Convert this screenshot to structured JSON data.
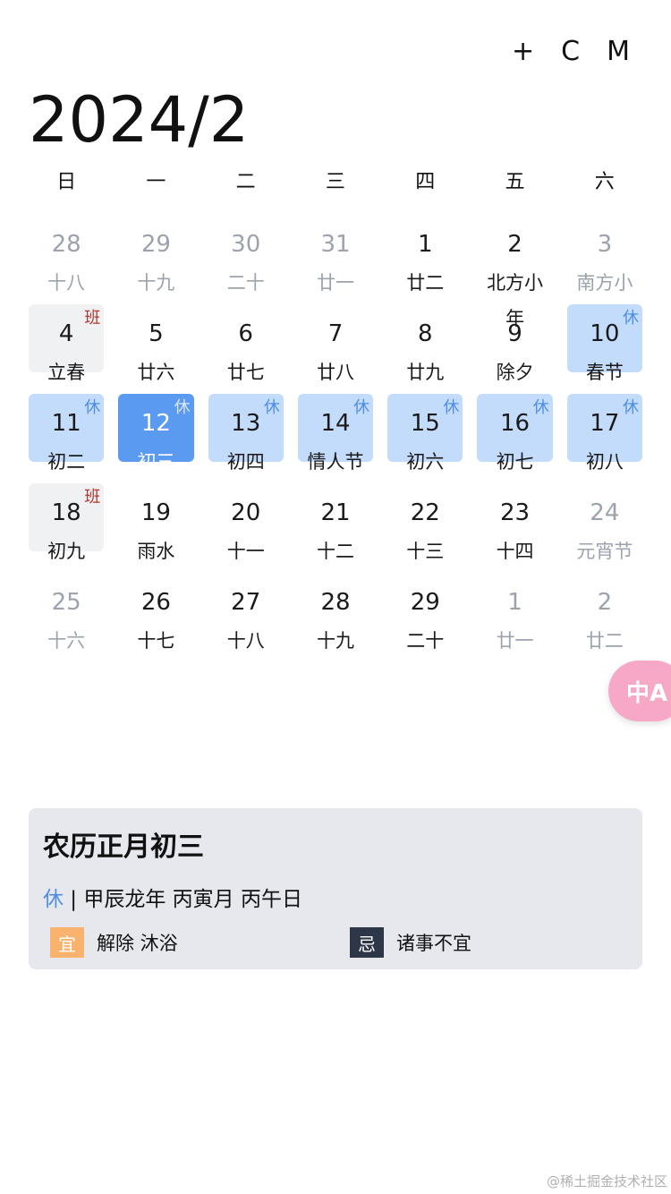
{
  "toolbar": {
    "add_label": "+",
    "c_label": "C",
    "m_label": "M"
  },
  "title": "2024/2",
  "weekdays": [
    "日",
    "一",
    "二",
    "三",
    "四",
    "五",
    "六"
  ],
  "days": [
    {
      "day": "28",
      "lunar": "十八",
      "other": true
    },
    {
      "day": "29",
      "lunar": "十九",
      "other": true
    },
    {
      "day": "30",
      "lunar": "二十",
      "other": true
    },
    {
      "day": "31",
      "lunar": "廿一",
      "other": true
    },
    {
      "day": "1",
      "lunar": "廿二"
    },
    {
      "day": "2",
      "lunar": "北方小年"
    },
    {
      "day": "3",
      "lunar": "南方小年",
      "other": true
    },
    {
      "day": "4",
      "lunar": "立春",
      "status": "work",
      "tag": "班"
    },
    {
      "day": "5",
      "lunar": "廿六"
    },
    {
      "day": "6",
      "lunar": "廿七"
    },
    {
      "day": "7",
      "lunar": "廿八"
    },
    {
      "day": "8",
      "lunar": "廿九"
    },
    {
      "day": "9",
      "lunar": "除夕"
    },
    {
      "day": "10",
      "lunar": "春节",
      "status": "rest",
      "tag": "休"
    },
    {
      "day": "11",
      "lunar": "初二",
      "status": "rest",
      "tag": "休"
    },
    {
      "day": "12",
      "lunar": "初三",
      "status": "rest",
      "tag": "休",
      "selected": true
    },
    {
      "day": "13",
      "lunar": "初四",
      "status": "rest",
      "tag": "休"
    },
    {
      "day": "14",
      "lunar": "情人节",
      "status": "rest",
      "tag": "休"
    },
    {
      "day": "15",
      "lunar": "初六",
      "status": "rest",
      "tag": "休"
    },
    {
      "day": "16",
      "lunar": "初七",
      "status": "rest",
      "tag": "休"
    },
    {
      "day": "17",
      "lunar": "初八",
      "status": "rest",
      "tag": "休"
    },
    {
      "day": "18",
      "lunar": "初九",
      "status": "work",
      "tag": "班"
    },
    {
      "day": "19",
      "lunar": "雨水"
    },
    {
      "day": "20",
      "lunar": "十一"
    },
    {
      "day": "21",
      "lunar": "十二"
    },
    {
      "day": "22",
      "lunar": "十三"
    },
    {
      "day": "23",
      "lunar": "十四"
    },
    {
      "day": "24",
      "lunar": "元宵节",
      "other": true
    },
    {
      "day": "25",
      "lunar": "十六",
      "other": true
    },
    {
      "day": "26",
      "lunar": "十七"
    },
    {
      "day": "27",
      "lunar": "十八"
    },
    {
      "day": "28",
      "lunar": "十九"
    },
    {
      "day": "29",
      "lunar": "二十"
    },
    {
      "day": "1",
      "lunar": "廿一",
      "other": true
    },
    {
      "day": "2",
      "lunar": "廿二",
      "other": true
    }
  ],
  "info": {
    "lunar_date": "农历正月初三",
    "tag": "休",
    "separator": " | ",
    "ganzhi": "甲辰龙年 丙寅月 丙午日",
    "yi_label": "宜",
    "yi_text": "解除 沐浴",
    "ji_label": "忌",
    "ji_text": "诸事不宜"
  },
  "float_button": {
    "label": "中A"
  },
  "footer": "@稀土掘金技术社区",
  "colors": {
    "rest_bg": "#c4dcfb",
    "selected_bg": "#5b9af1",
    "work_bg": "#f0f1f3",
    "rest_tag": "#4d8de6",
    "work_tag": "#b3342b",
    "yi_badge": "#f9b36e",
    "ji_badge": "#2d3748"
  },
  "icons": {
    "translate_button": "translate-icon"
  }
}
